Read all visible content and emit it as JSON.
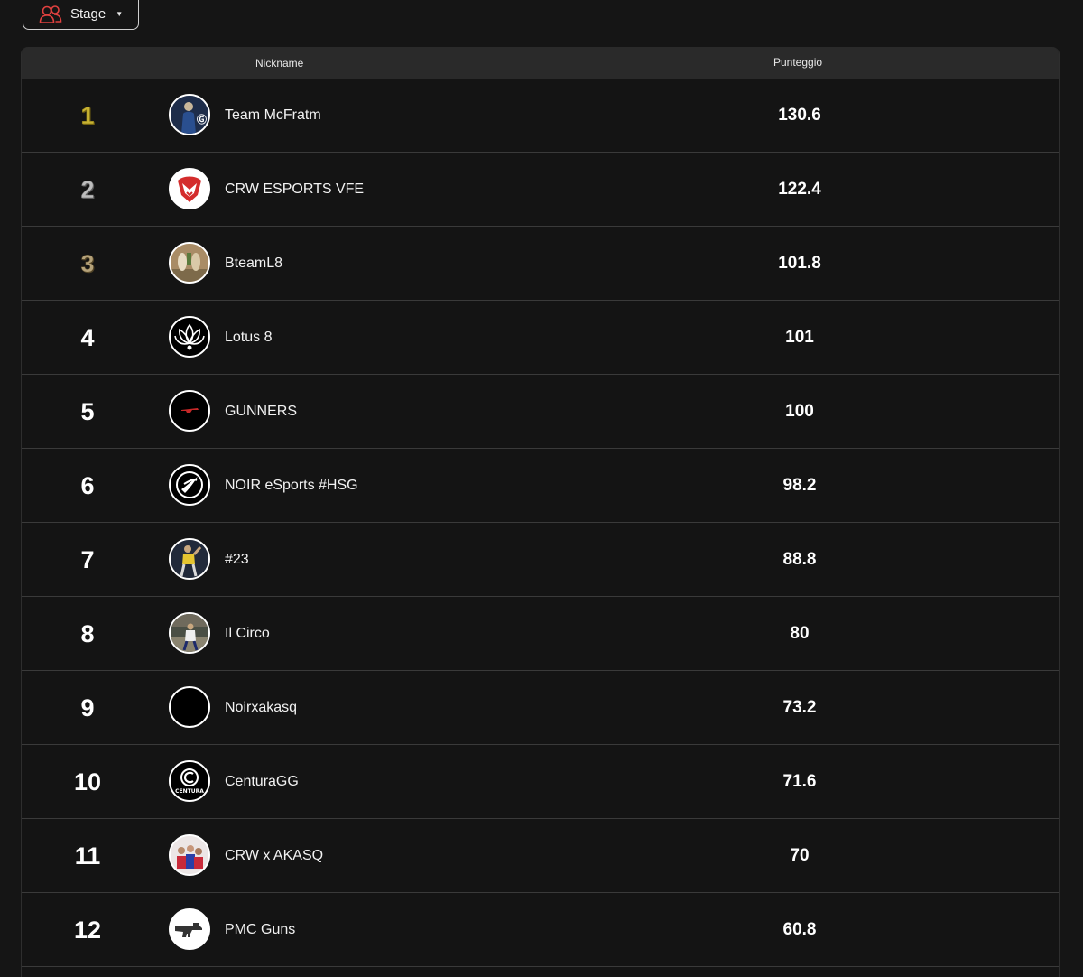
{
  "filter": {
    "stage_label": "Stage",
    "users_icon": "users-icon",
    "caret_icon": "caret-down-icon",
    "accent_color": "#e0413f"
  },
  "table": {
    "headers": {
      "nickname": "Nickname",
      "score": "Punteggio"
    },
    "rows": [
      {
        "rank": "1",
        "nickname": "Team McFratm",
        "score": "130.6",
        "medal": "gold"
      },
      {
        "rank": "2",
        "nickname": "CRW ESPORTS VFE",
        "score": "122.4",
        "medal": "silver"
      },
      {
        "rank": "3",
        "nickname": "BteamL8",
        "score": "101.8",
        "medal": "bronze"
      },
      {
        "rank": "4",
        "nickname": "Lotus 8",
        "score": "101"
      },
      {
        "rank": "5",
        "nickname": "GUNNERS",
        "score": "100"
      },
      {
        "rank": "6",
        "nickname": "NOIR eSports #HSG",
        "score": "98.2"
      },
      {
        "rank": "7",
        "nickname": "#23",
        "score": "88.8"
      },
      {
        "rank": "8",
        "nickname": "Il Circo",
        "score": "80"
      },
      {
        "rank": "9",
        "nickname": "Noirxakasq",
        "score": "73.2"
      },
      {
        "rank": "10",
        "nickname": "CenturaGG",
        "score": "71.6"
      },
      {
        "rank": "11",
        "nickname": "CRW x AKASQ",
        "score": "70"
      },
      {
        "rank": "12",
        "nickname": "PMC Guns",
        "score": "60.8"
      }
    ]
  },
  "avatars": {
    "row0": "Ⓖ",
    "row9": "CENTURA"
  }
}
